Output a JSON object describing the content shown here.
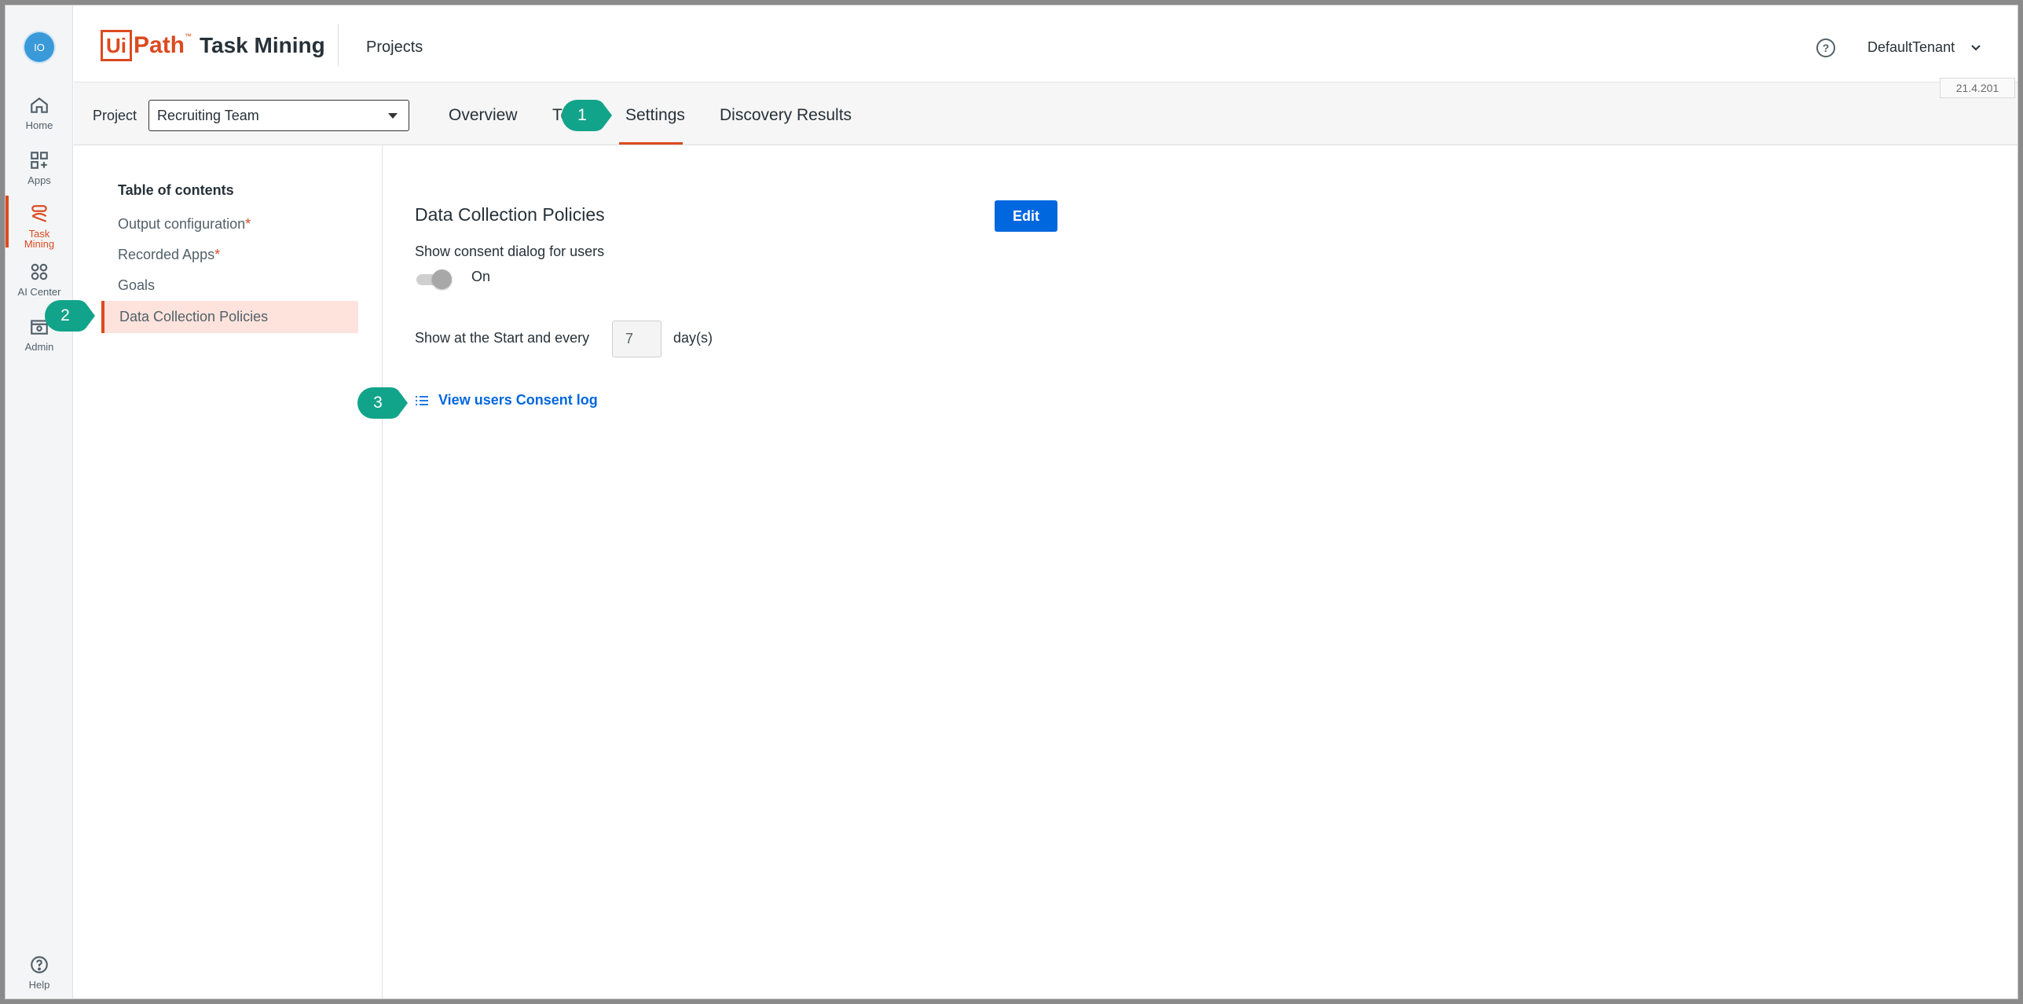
{
  "rail": {
    "avatar": "IO",
    "items": [
      {
        "label": "Home",
        "icon": "home-icon"
      },
      {
        "label": "Apps",
        "icon": "apps-icon"
      },
      {
        "label_line1": "Task",
        "label_line2": "Mining",
        "icon": "task-mining-icon"
      },
      {
        "label": "AI Center",
        "icon": "ai-center-icon"
      },
      {
        "label": "Admin",
        "icon": "admin-icon"
      },
      {
        "label": "Help",
        "icon": "help-icon"
      }
    ]
  },
  "header": {
    "logo_ui": "Ui",
    "logo_path": "Path",
    "logo_tm": "™",
    "logo_product": "Task Mining",
    "nav_projects": "Projects",
    "help_glyph": "?",
    "tenant": "DefaultTenant"
  },
  "subbar": {
    "project_label": "Project",
    "project_value": "Recruiting Team",
    "tabs": [
      "Overview",
      "Te",
      "Settings",
      "Discovery Results"
    ],
    "active_tab": "Settings",
    "version": "21.4.201"
  },
  "toc": {
    "title": "Table of contents",
    "items": [
      {
        "label": "Output configuration",
        "required": "*"
      },
      {
        "label": "Recorded Apps",
        "required": "*"
      },
      {
        "label": "Goals",
        "required": ""
      },
      {
        "label": "Data Collection Policies",
        "required": ""
      }
    ],
    "active": "Data Collection Policies"
  },
  "main": {
    "section_title": "Data Collection Policies",
    "edit_label": "Edit",
    "consent_label": "Show consent dialog for users",
    "toggle_state": "On",
    "every_label": "Show at the Start and every",
    "days_value": "7",
    "days_unit": "day(s)",
    "log_link": "View users Consent log"
  },
  "callouts": [
    "1",
    "2",
    "3"
  ],
  "colors": {
    "accent": "#dc4a20",
    "primary": "#0067df",
    "callout": "#12a48a",
    "toc_active_bg": "#fde3dc"
  }
}
